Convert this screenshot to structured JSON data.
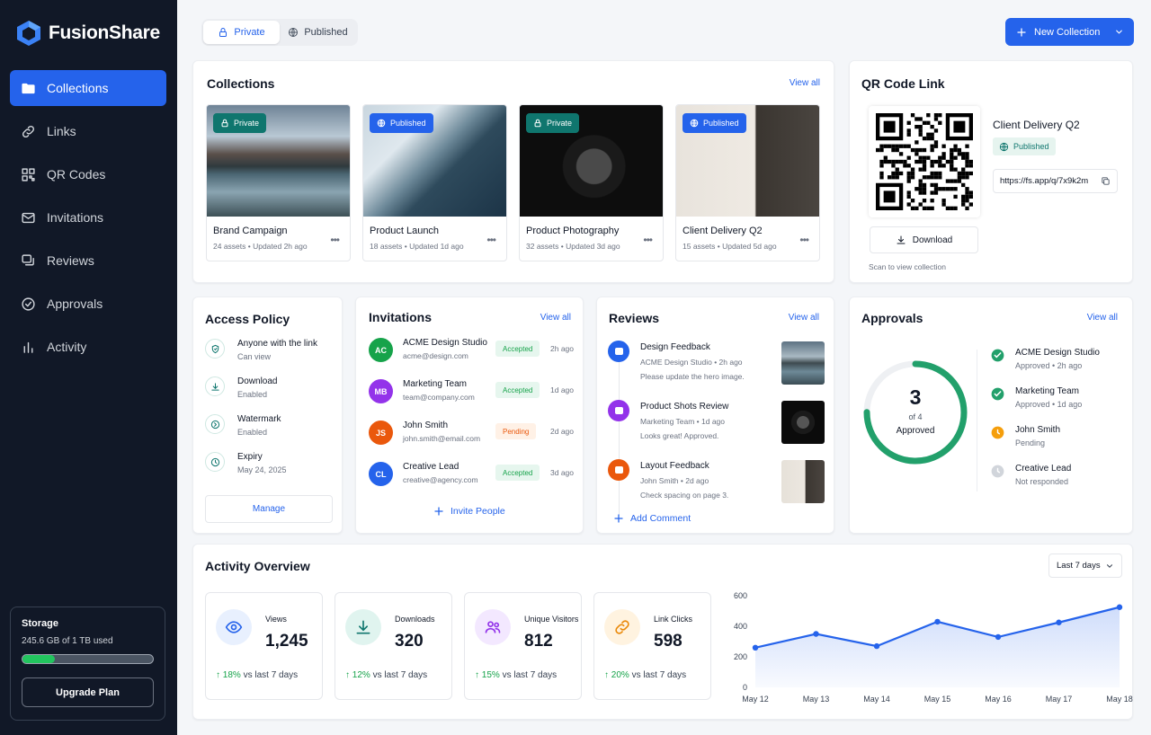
{
  "app": {
    "name": "FusionShare"
  },
  "nav": [
    {
      "label": "Collections",
      "icon": "folder-icon",
      "active": true
    },
    {
      "label": "Links",
      "icon": "link-icon"
    },
    {
      "label": "QR Codes",
      "icon": "qr-icon"
    },
    {
      "label": "Invitations",
      "icon": "mail-icon"
    },
    {
      "label": "Reviews",
      "icon": "reviews-icon"
    },
    {
      "label": "Approvals",
      "icon": "check-circle-icon"
    },
    {
      "label": "Activity",
      "icon": "bar-chart-icon"
    }
  ],
  "storage": {
    "title": "Storage",
    "used": "245.6 GB of 1 TB used",
    "fraction": 0.246,
    "button": "Upgrade Plan"
  },
  "header": {
    "tabs": [
      "Private",
      "Published"
    ],
    "active_tab": "Private",
    "new_button": "New Collection"
  },
  "collections": {
    "title": "Collections",
    "view_all": "View all",
    "items": [
      {
        "name": "Brand Campaign",
        "meta": "24 assets • Updated 2h ago",
        "badge": "Private",
        "badge_color": "#0f766e"
      },
      {
        "name": "Product Launch",
        "meta": "18 assets • Updated 1d ago",
        "badge": "Published",
        "badge_color": "#2563eb"
      },
      {
        "name": "Product Photography",
        "meta": "32 assets • Updated 3d ago",
        "badge": "Private",
        "badge_color": "#0f766e"
      },
      {
        "name": "Client Delivery Q2",
        "meta": "15 assets • Updated 5d ago",
        "badge": "Published",
        "badge_color": "#2563eb"
      }
    ]
  },
  "qr": {
    "title": "QR Code Link",
    "name": "Client Delivery Q2",
    "status": "Published",
    "url": "https://fs.app/q/7x9k2m",
    "download": "Download",
    "caption": "Scan to view collection"
  },
  "access": {
    "title": "Access Policy",
    "items": [
      {
        "label": "Anyone with the link",
        "sub": "Can view",
        "icon": "shield-icon"
      },
      {
        "label": "Download",
        "sub": "Enabled",
        "icon": "download-icon"
      },
      {
        "label": "Watermark",
        "sub": "Enabled",
        "icon": "watermark-icon"
      },
      {
        "label": "Expiry",
        "sub": "May 24, 2025",
        "icon": "clock-icon"
      }
    ],
    "button": "Manage"
  },
  "invitations": {
    "title": "Invitations",
    "view_all": "View all",
    "items": [
      {
        "initials": "AC",
        "name": "ACME Design Studio",
        "email": "acme@design.com",
        "status": "Accepted",
        "time": "2h ago",
        "color": "#16a34a"
      },
      {
        "initials": "MB",
        "name": "Marketing Team",
        "email": "team@company.com",
        "status": "Accepted",
        "time": "1d ago",
        "color": "#9333ea"
      },
      {
        "initials": "JS",
        "name": "John Smith",
        "email": "john.smith@email.com",
        "status": "Pending",
        "time": "2d ago",
        "color": "#ea580c"
      },
      {
        "initials": "CL",
        "name": "Creative Lead",
        "email": "creative@agency.com",
        "status": "Accepted",
        "time": "3d ago",
        "color": "#2563eb"
      }
    ],
    "button": "Invite People"
  },
  "reviews": {
    "title": "Reviews",
    "view_all": "View all",
    "items": [
      {
        "title": "Design Feedback",
        "meta": "ACME Design Studio • 2h ago",
        "text": "Please update the hero image.",
        "color": "#2563eb"
      },
      {
        "title": "Product Shots Review",
        "meta": "Marketing Team • 1d ago",
        "text": "Looks great! Approved.",
        "color": "#9333ea"
      },
      {
        "title": "Layout Feedback",
        "meta": "John Smith • 2d ago",
        "text": "Check spacing on page 3.",
        "color": "#ea580c"
      }
    ],
    "button": "Add Comment"
  },
  "approvals": {
    "title": "Approvals",
    "view_all": "View all",
    "count": "3",
    "of": "of 4",
    "label": "Approved",
    "fraction": 0.75,
    "items": [
      {
        "name": "ACME Design Studio",
        "sub": "Approved • 2h ago",
        "state": "approved"
      },
      {
        "name": "Marketing Team",
        "sub": "Approved • 1d ago",
        "state": "approved"
      },
      {
        "name": "John Smith",
        "sub": "Pending",
        "state": "pending"
      },
      {
        "name": "Creative Lead",
        "sub": "Not responded",
        "state": "none"
      }
    ]
  },
  "activity": {
    "title": "Activity Overview",
    "range": "Last 7 days",
    "stats": [
      {
        "label": "Views",
        "value": "1,245",
        "pct": "18%",
        "vs": "vs last 7 days",
        "icon": "eye-icon",
        "color": "#2563eb",
        "bg": "#e8f0fe"
      },
      {
        "label": "Downloads",
        "value": "320",
        "pct": "12%",
        "vs": "vs last 7 days",
        "icon": "download-icon",
        "color": "#0f766e",
        "bg": "#e0f4ef"
      },
      {
        "label": "Unique Visitors",
        "value": "812",
        "pct": "15%",
        "vs": "vs last 7 days",
        "icon": "users-icon",
        "color": "#9333ea",
        "bg": "#f3e8ff"
      },
      {
        "label": "Link Clicks",
        "value": "598",
        "pct": "20%",
        "vs": "vs last 7 days",
        "icon": "link-icon",
        "color": "#ea8a0c",
        "bg": "#fff3e0"
      }
    ]
  },
  "chart_data": {
    "type": "area",
    "x": [
      "May 12",
      "May 13",
      "May 14",
      "May 15",
      "May 16",
      "May 17",
      "May 18"
    ],
    "series": [
      {
        "values": [
          260,
          350,
          270,
          430,
          330,
          425,
          525
        ]
      }
    ],
    "ylim": [
      0,
      600
    ],
    "yticks": [
      0,
      200,
      400,
      600
    ],
    "grid": false,
    "color": "#2563eb"
  }
}
